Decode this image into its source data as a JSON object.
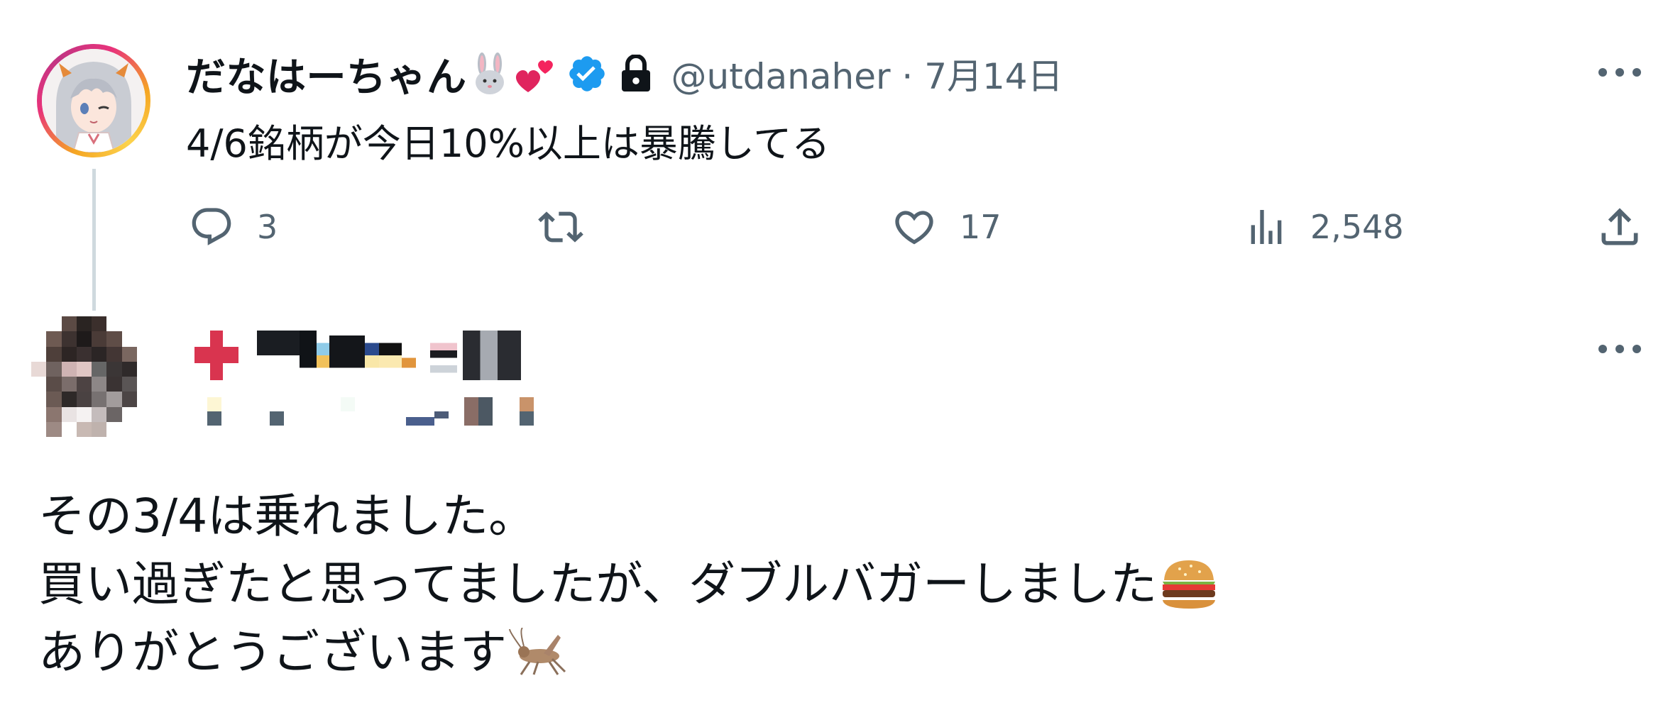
{
  "tweet": {
    "author": {
      "display_name": "だなはーちゃん",
      "handle_time": "@utdanaher · 7月14日",
      "badges": [
        "rabbit-emoji",
        "two-hearts-emoji",
        "verified-badge-icon",
        "lock-icon"
      ]
    },
    "text": "4/6銘柄が今日10%以上は暴騰してる",
    "stats": {
      "replies": "3",
      "retweets": "",
      "likes": "17",
      "views": "2,548"
    }
  },
  "reply": {
    "author": {
      "display_name": "",
      "handle": "",
      "obscured": true
    },
    "lines": [
      "その3/4は乗れました。",
      "買い過ぎたと思ってましたが、ダブルバガーしました",
      "ありがとうございます"
    ],
    "line_emojis": [
      "",
      "hamburger-emoji",
      "cricket-emoji"
    ]
  },
  "colors": {
    "text_primary": "#0f1419",
    "text_secondary": "#536471",
    "verified_blue": "#1d9bf0",
    "thread_line": "#cfd9de"
  }
}
